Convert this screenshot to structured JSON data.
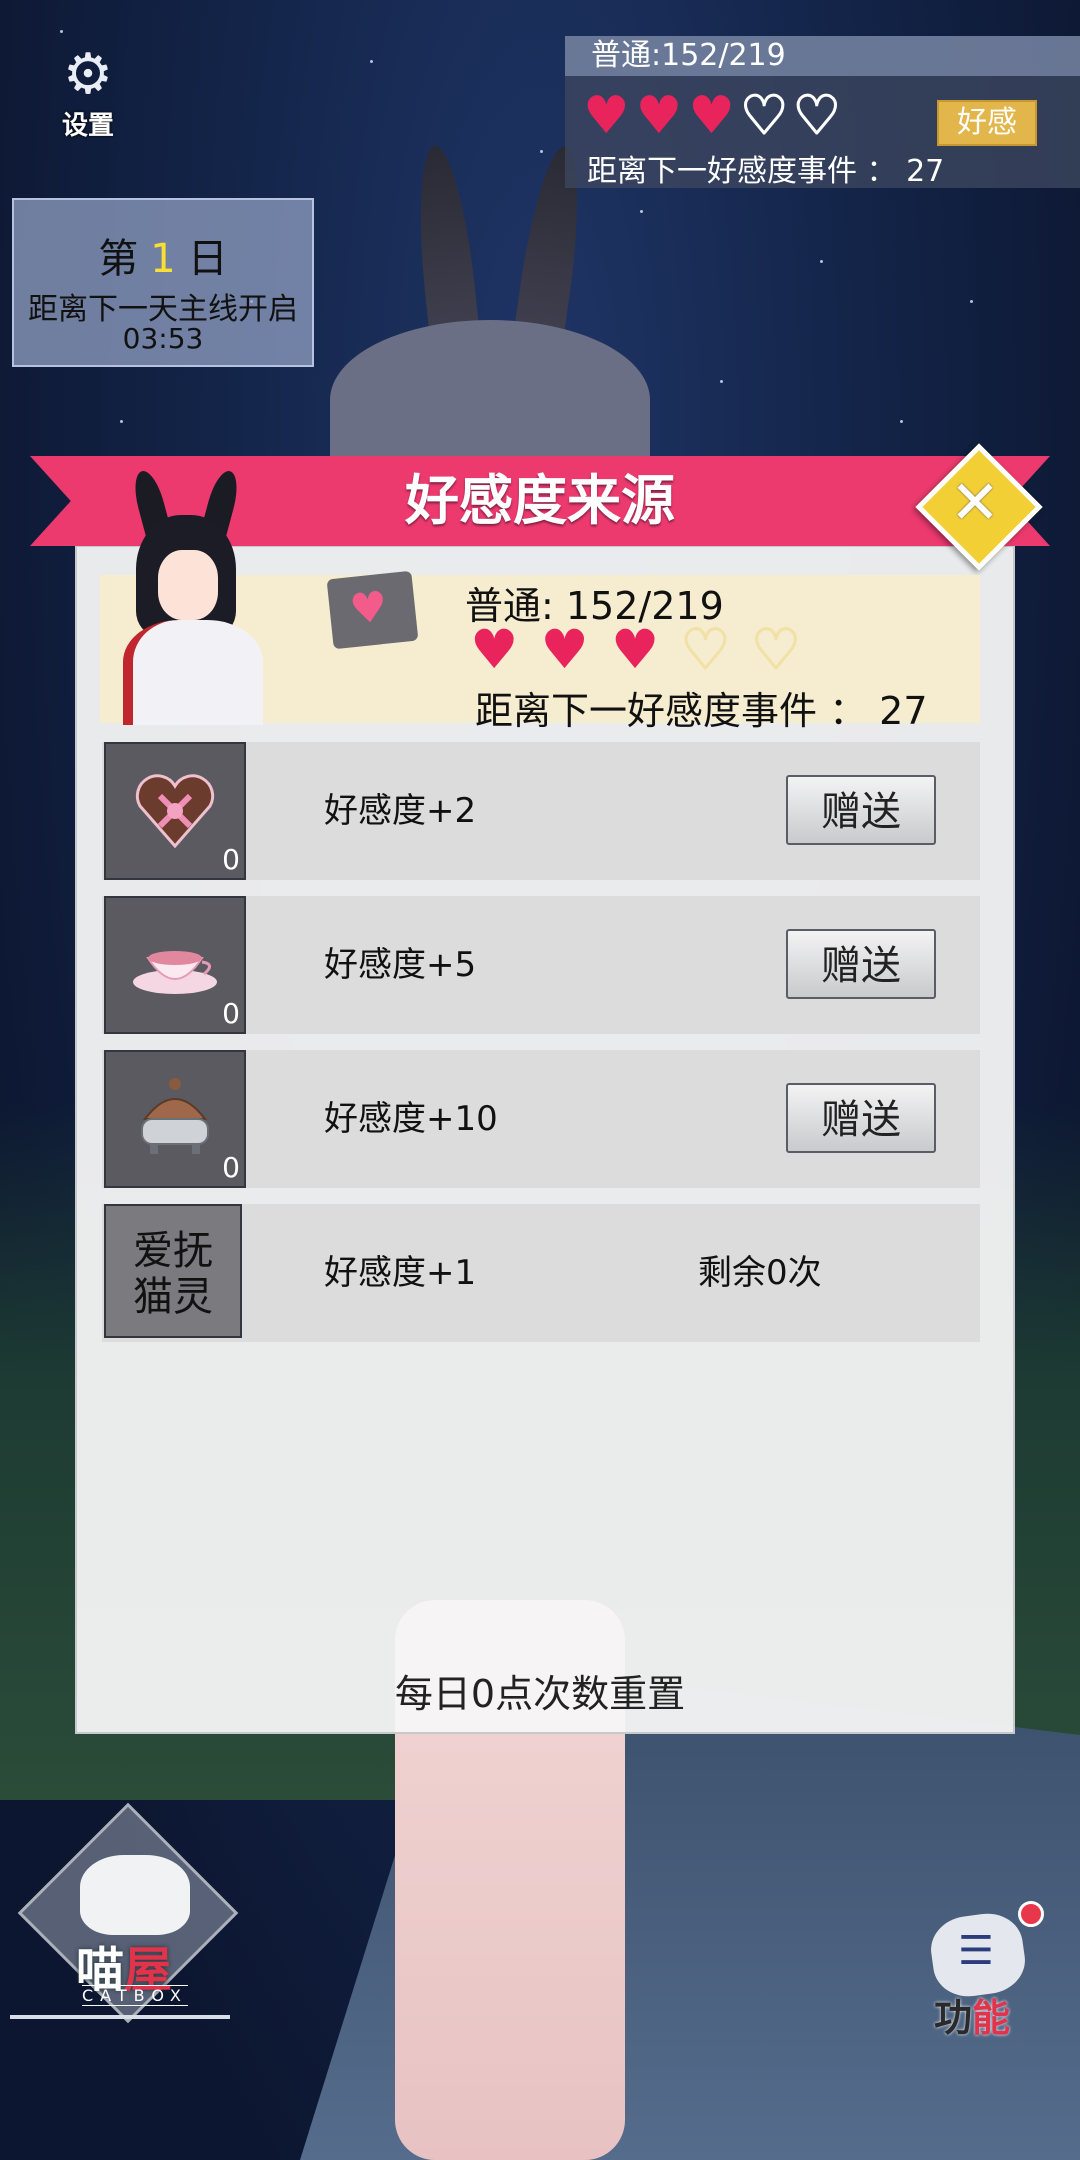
{
  "settings": {
    "label": "设置",
    "icon": "gear-icon"
  },
  "affection_top": {
    "status": "普通:152/219",
    "hearts_filled": 3,
    "hearts_total": 5,
    "button_label": "好感",
    "next_event": "距离下一好感度事件 ： 27"
  },
  "day": {
    "prefix": "第",
    "number": "1",
    "suffix": "日",
    "subtitle": "距离下一天主线开启",
    "countdown": "03:53"
  },
  "modal": {
    "title": "好感度来源",
    "status": "普通: 152/219",
    "next_event": "距离下一好感度事件 ： 27",
    "reset_note": "每日0点次数重置"
  },
  "gifts": [
    {
      "icon": "chocolate-heart-box-icon",
      "count": "0",
      "label": "好感度+2",
      "button": "赠送"
    },
    {
      "icon": "teacup-icon",
      "count": "0",
      "label": "好感度+5",
      "button": "赠送"
    },
    {
      "icon": "incense-burner-icon",
      "count": "0",
      "label": "好感度+10",
      "button": "赠送"
    }
  ],
  "pet": {
    "icon_text": "爱抚\n猫灵",
    "label": "好感度+1",
    "remaining": "剩余0次"
  },
  "catbox": {
    "label_main": "喵",
    "label_accent": "屋",
    "sub": "CATBOX"
  },
  "function": {
    "label_main": "功",
    "label_accent": "能"
  },
  "colors": {
    "accent": "#ec3a6f",
    "heart": "#e9245d",
    "gold": "#f3cf36"
  }
}
